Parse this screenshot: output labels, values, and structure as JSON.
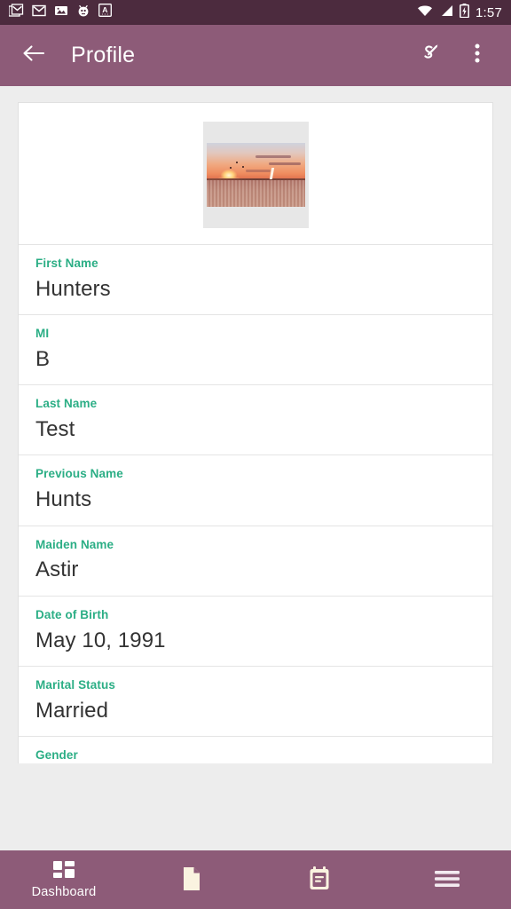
{
  "statusbar": {
    "time": "1:57",
    "left_icons": [
      {
        "name": "gmail-stacked-icon"
      },
      {
        "name": "gmail-icon"
      },
      {
        "name": "image-icon"
      },
      {
        "name": "bug-droid-icon"
      },
      {
        "name": "font-a-icon"
      }
    ],
    "right_icons": [
      {
        "name": "wifi-icon"
      },
      {
        "name": "cellular-signal-icon"
      },
      {
        "name": "battery-charging-icon"
      }
    ]
  },
  "appbar": {
    "title": "Profile",
    "back_icon": "back-arrow-icon",
    "signature_icon": "signature-icon",
    "overflow_icon": "overflow-menu-icon",
    "background": "#8D5B78"
  },
  "profile": {
    "photo_alt": "sunset-over-water-photo",
    "fields": [
      {
        "label": "First Name",
        "value": "Hunters"
      },
      {
        "label": "MI",
        "value": "B"
      },
      {
        "label": "Last Name",
        "value": "Test"
      },
      {
        "label": "Previous Name",
        "value": "Hunts"
      },
      {
        "label": "Maiden Name",
        "value": "Astir"
      },
      {
        "label": "Date of Birth",
        "value": "May 10, 1991"
      },
      {
        "label": "Marital Status",
        "value": "Married"
      },
      {
        "label": "Gender",
        "value": ""
      }
    ],
    "label_color": "#2BAE85",
    "value_color": "#333333"
  },
  "bottomnav": {
    "items": [
      {
        "label": "Dashboard",
        "icon": "dashboard-grid-icon"
      },
      {
        "label": "",
        "icon": "document-page-icon"
      },
      {
        "label": "",
        "icon": "calendar-note-icon"
      },
      {
        "label": "",
        "icon": "hamburger-menu-icon"
      }
    ],
    "background": "#8D5B78"
  }
}
